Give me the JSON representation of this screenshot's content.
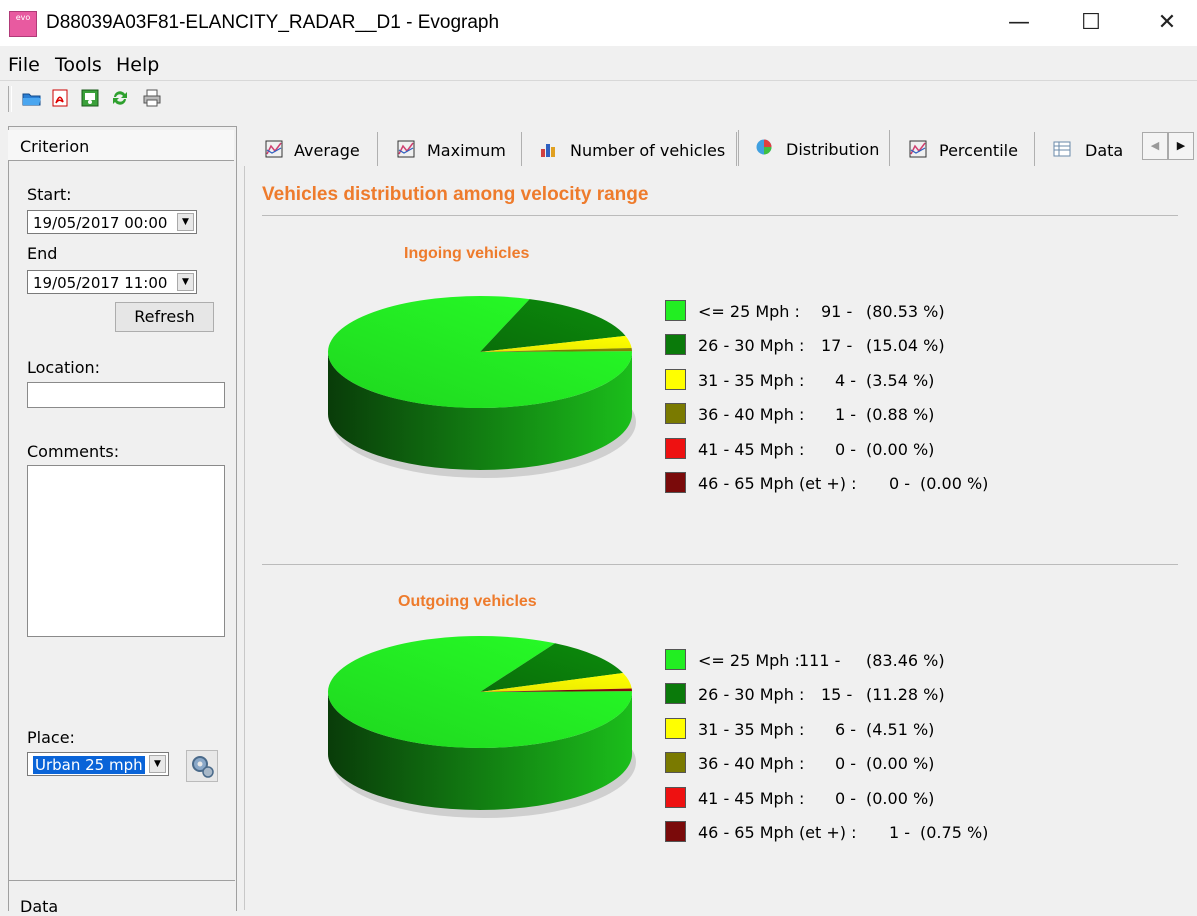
{
  "window": {
    "title": "D88039A03F81-ELANCITY_RADAR__D1 - Evograph",
    "icon_text": "evo",
    "minimize": "—",
    "maximize": "☐",
    "close": "✕"
  },
  "menu": [
    "File",
    "Tools",
    "Help"
  ],
  "toolbar_icons": [
    "open-folder-icon",
    "pdf-icon",
    "export-image-icon",
    "refresh-icon",
    "print-icon"
  ],
  "left": {
    "header": "Criterion",
    "start_label": "Start:",
    "start_value": "19/05/2017 00:00",
    "end_label": "End",
    "end_value": "19/05/2017 11:00",
    "refresh": "Refresh",
    "location_label": "Location:",
    "location_value": "",
    "comments_label": "Comments:",
    "comments_value": "",
    "place_label": "Place:",
    "place_value": "Urban 25 mph",
    "data_header": "Data"
  },
  "tabs": [
    {
      "label": "Average",
      "icon": "line-chart-icon"
    },
    {
      "label": "Maximum",
      "icon": "line-chart-icon"
    },
    {
      "label": "Number of vehicles",
      "icon": "bar-chart-icon"
    },
    {
      "label": "Distribution",
      "icon": "pie-chart-icon",
      "active": true
    },
    {
      "label": "Percentile",
      "icon": "line-chart-icon"
    },
    {
      "label": "Data",
      "icon": "table-icon"
    }
  ],
  "main": {
    "title": "Vehicles distribution among velocity range"
  },
  "colors": {
    "r1": "#22ee22",
    "r2": "#0a7a0a",
    "r3": "#ffff00",
    "r4": "#7a7a00",
    "r5": "#ee1111",
    "r6": "#7a0a0a",
    "accent": "#ee7b2c"
  },
  "chart_data": [
    {
      "type": "pie",
      "title": "Ingoing vehicles",
      "categories": [
        "<= 25 Mph :",
        "26 - 30 Mph :",
        "31 - 35 Mph :",
        "36 - 40 Mph :",
        "41 - 45 Mph :",
        "46 - 65 Mph (et +) :"
      ],
      "values": [
        91,
        17,
        4,
        1,
        0,
        0
      ],
      "percent_labels": [
        "(80.53 %)",
        "(15.04 %)",
        "(3.54 %)",
        "(0.88 %)",
        "(0.00 %)",
        "(0.00 %)"
      ]
    },
    {
      "type": "pie",
      "title": "Outgoing vehicles",
      "categories": [
        "<= 25 Mph :",
        "26 - 30 Mph :",
        "31 - 35 Mph :",
        "36 - 40 Mph :",
        "41 - 45 Mph :",
        "46 - 65 Mph (et +) :"
      ],
      "values": [
        111,
        15,
        6,
        0,
        0,
        1
      ],
      "percent_labels": [
        "(83.46 %)",
        "(11.28 %)",
        "(4.51 %)",
        "(0.00 %)",
        "(0.00 %)",
        "(0.75 %)"
      ]
    }
  ]
}
